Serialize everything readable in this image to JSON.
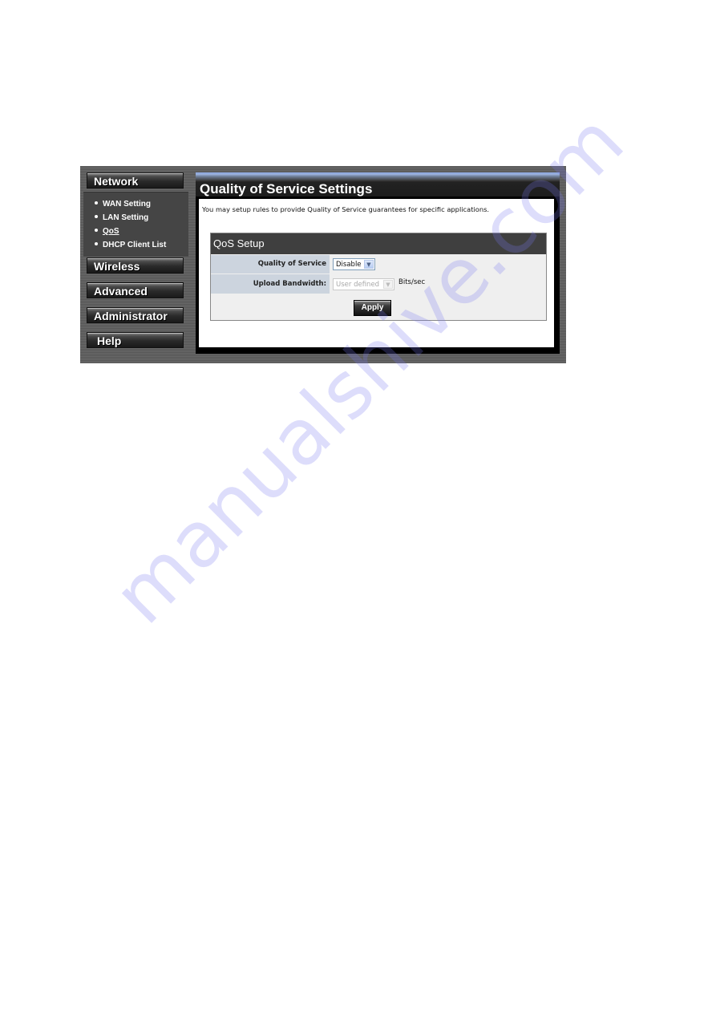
{
  "sidebar": {
    "sections": [
      {
        "label": "Network",
        "expanded": true
      },
      {
        "label": "Wireless"
      },
      {
        "label": "Advanced"
      },
      {
        "label": "Administrator"
      },
      {
        "label": "Help"
      }
    ],
    "network_items": [
      {
        "label": "WAN Setting"
      },
      {
        "label": "LAN Setting"
      },
      {
        "label": "QoS",
        "active": true
      },
      {
        "label": "DHCP Client List"
      }
    ]
  },
  "page": {
    "title": "Quality of Service Settings",
    "description": "You may setup rules to provide Quality of Service guarantees for specific applications."
  },
  "qos_setup": {
    "heading": "QoS Setup",
    "fields": {
      "quality_of_service": {
        "label": "Quality of Service",
        "value": "Disable"
      },
      "upload_bandwidth": {
        "label": "Upload Bandwidth:",
        "value": "User defined",
        "unit": "Bits/sec",
        "disabled": true
      }
    },
    "apply_label": "Apply"
  },
  "watermark": "manualshive.com",
  "colors": {
    "title_accent": "#9fb6e4",
    "label_cell": "#ccd4de",
    "box_header": "#3f3f3f"
  }
}
